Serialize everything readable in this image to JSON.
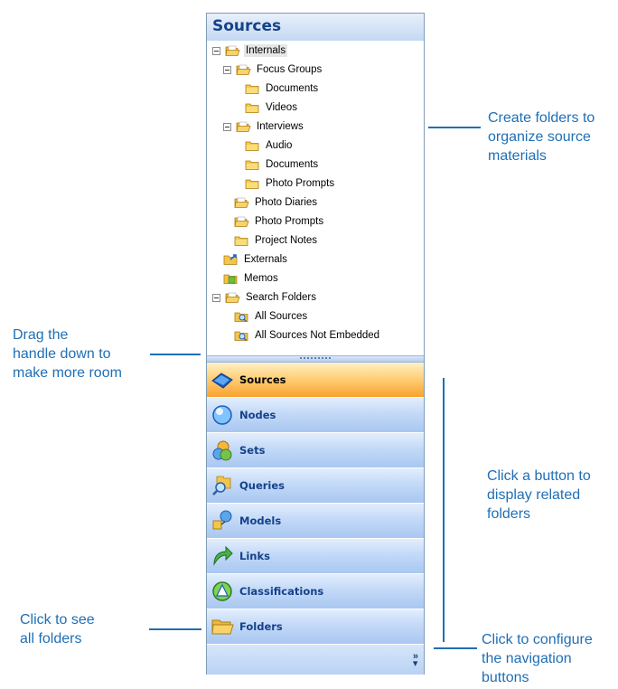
{
  "panel": {
    "title": "Sources",
    "tree": [
      {
        "label": "Internals",
        "indent": 0,
        "expander": "minus",
        "icon": "open-folder",
        "selected": true
      },
      {
        "label": "Focus Groups",
        "indent": 1,
        "expander": "minus",
        "icon": "open-folder"
      },
      {
        "label": "Documents",
        "indent": 3,
        "expander": "none",
        "icon": "folder"
      },
      {
        "label": "Videos",
        "indent": 3,
        "expander": "none",
        "icon": "folder"
      },
      {
        "label": "Interviews",
        "indent": 1,
        "expander": "minus",
        "icon": "open-folder"
      },
      {
        "label": "Audio",
        "indent": 3,
        "expander": "none",
        "icon": "folder"
      },
      {
        "label": "Documents",
        "indent": 3,
        "expander": "none",
        "icon": "folder"
      },
      {
        "label": "Photo Prompts",
        "indent": 3,
        "expander": "none",
        "icon": "folder"
      },
      {
        "label": "Photo Diaries",
        "indent": 2,
        "expander": "none",
        "icon": "open-folder"
      },
      {
        "label": "Photo Prompts",
        "indent": 2,
        "expander": "none",
        "icon": "open-folder"
      },
      {
        "label": "Project Notes",
        "indent": 2,
        "expander": "none",
        "icon": "folder"
      },
      {
        "label": "Externals",
        "indent": 1,
        "expander": "none",
        "icon": "externals-folder"
      },
      {
        "label": "Memos",
        "indent": 1,
        "expander": "none",
        "icon": "memos-folder"
      },
      {
        "label": "Search Folders",
        "indent": 0,
        "expander": "minus",
        "icon": "open-folder"
      },
      {
        "label": "All Sources",
        "indent": 2,
        "expander": "none",
        "icon": "search-folder"
      },
      {
        "label": "All Sources Not Embedded",
        "indent": 2,
        "expander": "none",
        "icon": "search-folder"
      }
    ],
    "nav_buttons": [
      {
        "label": "Sources",
        "icon": "sources-icon",
        "active": true
      },
      {
        "label": "Nodes",
        "icon": "nodes-icon",
        "active": false
      },
      {
        "label": "Sets",
        "icon": "sets-icon",
        "active": false
      },
      {
        "label": "Queries",
        "icon": "queries-icon",
        "active": false
      },
      {
        "label": "Models",
        "icon": "models-icon",
        "active": false
      },
      {
        "label": "Links",
        "icon": "links-icon",
        "active": false
      },
      {
        "label": "Classifications",
        "icon": "classifications-icon",
        "active": false
      },
      {
        "label": "Folders",
        "icon": "folders-icon",
        "active": false
      }
    ],
    "configure_icon": "chevron-double-right-icon"
  },
  "callouts": {
    "create_folders": [
      "Create folders to",
      "organize source",
      "materials"
    ],
    "drag_handle": [
      "Drag the",
      "handle down to",
      "make more room"
    ],
    "click_button": [
      "Click a button to",
      "display related",
      "folders"
    ],
    "click_see": [
      "Click to see",
      "all folders"
    ],
    "click_configure": [
      "Click to configure",
      "the navigation",
      "buttons"
    ]
  },
  "colors": {
    "callout_text": "#1f6fb5",
    "header_text": "#15428b",
    "active_button": "#f9a22c",
    "button_blue": "#c3d9f8"
  }
}
